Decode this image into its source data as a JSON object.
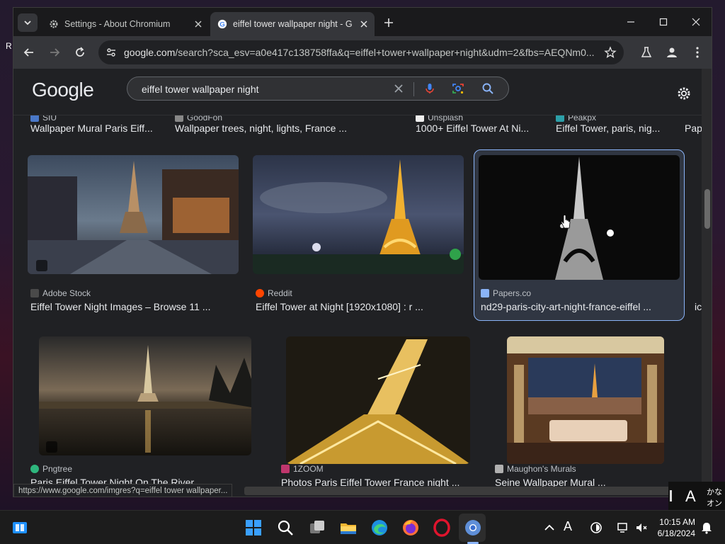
{
  "desktop": {
    "frag_r": "R"
  },
  "tabs": [
    {
      "title": "Settings - About Chromium",
      "icon": "gear-icon"
    },
    {
      "title": "eiffel tower wallpaper night - G",
      "icon": "google-g-icon"
    }
  ],
  "omnibox": {
    "host": "google.com",
    "path": "/search?sca_esv=a0e417c138758ffa&q=eiffel+tower+wallpaper+night&udm=2&fbs=AEQNm0..."
  },
  "google": {
    "logo": "Google",
    "query": "eiffel tower wallpaper night"
  },
  "row0": [
    {
      "source": "SIU",
      "caption": "Wallpaper Mural Paris Eiff..."
    },
    {
      "source": "GoodFon",
      "caption": "Wallpaper trees, night, lights, France ..."
    },
    {
      "source": "Unsplash",
      "caption": "1000+ Eiffel Tower At Ni..."
    },
    {
      "source": "Peakpx",
      "caption": "Eiffel Tower, paris, nig..."
    },
    {
      "source": "",
      "caption": "Pap"
    }
  ],
  "row1": [
    {
      "source": "Adobe Stock",
      "caption": "Eiffel Tower Night Images – Browse 11 ...",
      "fav": "#4a4a4a"
    },
    {
      "source": "Reddit",
      "caption": "Eiffel Tower at Night [1920x1080] : r ...",
      "fav": "#ff4500"
    },
    {
      "source": "Papers.co",
      "caption": "nd29-paris-city-art-night-france-eiffel ...",
      "fav": "#8ab4f8"
    },
    {
      "source": "",
      "caption": "ic"
    }
  ],
  "row2": [
    {
      "source": "Pngtree",
      "caption": "Paris Eiffel Tower Night On The River",
      "fav": "#2eb67d"
    },
    {
      "source": "1ZOOM",
      "caption": "Photos Paris Eiffel Tower France night ...",
      "fav": "#c0366d"
    },
    {
      "source": "Maughon's Murals",
      "caption": "Seine Wallpaper Mural ...",
      "fav": "#b0b0b0"
    }
  ],
  "statusbar": {
    "url": "https://www.google.com/imgres?q=eiffel tower wallpaper..."
  },
  "ime": {
    "mode": "A",
    "kana": "かな",
    "on": "オン"
  },
  "clock": {
    "time": "10:15 AM",
    "date": "6/18/2024"
  },
  "taskbar": {
    "tray_font": "A"
  },
  "colors": {
    "accent": "#8ab4f8",
    "mic": "#4285f4"
  }
}
